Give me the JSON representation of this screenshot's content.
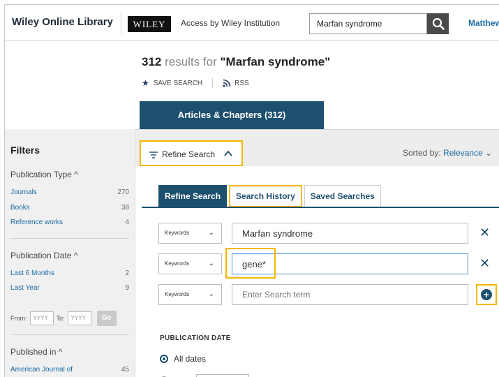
{
  "header": {
    "brand": "Wiley Online Library",
    "logo": "WILEY",
    "access": "Access by Wiley Institution",
    "search_value": "Marfan syndrome",
    "user": "Matthew"
  },
  "results": {
    "count": "312",
    "label": "results for",
    "query": "\"Marfan syndrome\"",
    "save_search": "SAVE SEARCH",
    "rss": "RSS"
  },
  "content_tab": "Articles & Chapters (312)",
  "toolbar": {
    "refine": "Refine Search",
    "sorted_label": "Sorted by:",
    "sorted_value": "Relevance"
  },
  "sidebar": {
    "title": "Filters",
    "publication_type": {
      "label": "Publication Type",
      "items": [
        {
          "label": "Journals",
          "count": "270"
        },
        {
          "label": "Books",
          "count": "38"
        },
        {
          "label": "Reference works",
          "count": "4"
        }
      ]
    },
    "publication_date": {
      "label": "Publication Date",
      "items": [
        {
          "label": "Last 6 Months",
          "count": "2"
        },
        {
          "label": "Last Year",
          "count": "9"
        }
      ],
      "from": "From:",
      "to": "To:",
      "year_placeholder": "YYYY",
      "go": "Go"
    },
    "published_in": {
      "label": "Published in",
      "items": [
        {
          "label": "American Journal of",
          "count": "45"
        }
      ]
    }
  },
  "panel": {
    "tabs": [
      "Refine Search",
      "Search History",
      "Saved Searches"
    ],
    "rows": [
      {
        "field": "Keywords",
        "value": "Marfan syndrome"
      },
      {
        "field": "Keywords",
        "value": "gene*"
      },
      {
        "field": "Keywords",
        "placeholder": "Enter Search term"
      }
    ],
    "pub_date_heading": "PUBLICATION DATE",
    "all_dates": "All dates"
  },
  "colors": {
    "accent": "#1d4f6e",
    "highlight": "#f5b800",
    "link": "#1a6aa3"
  }
}
